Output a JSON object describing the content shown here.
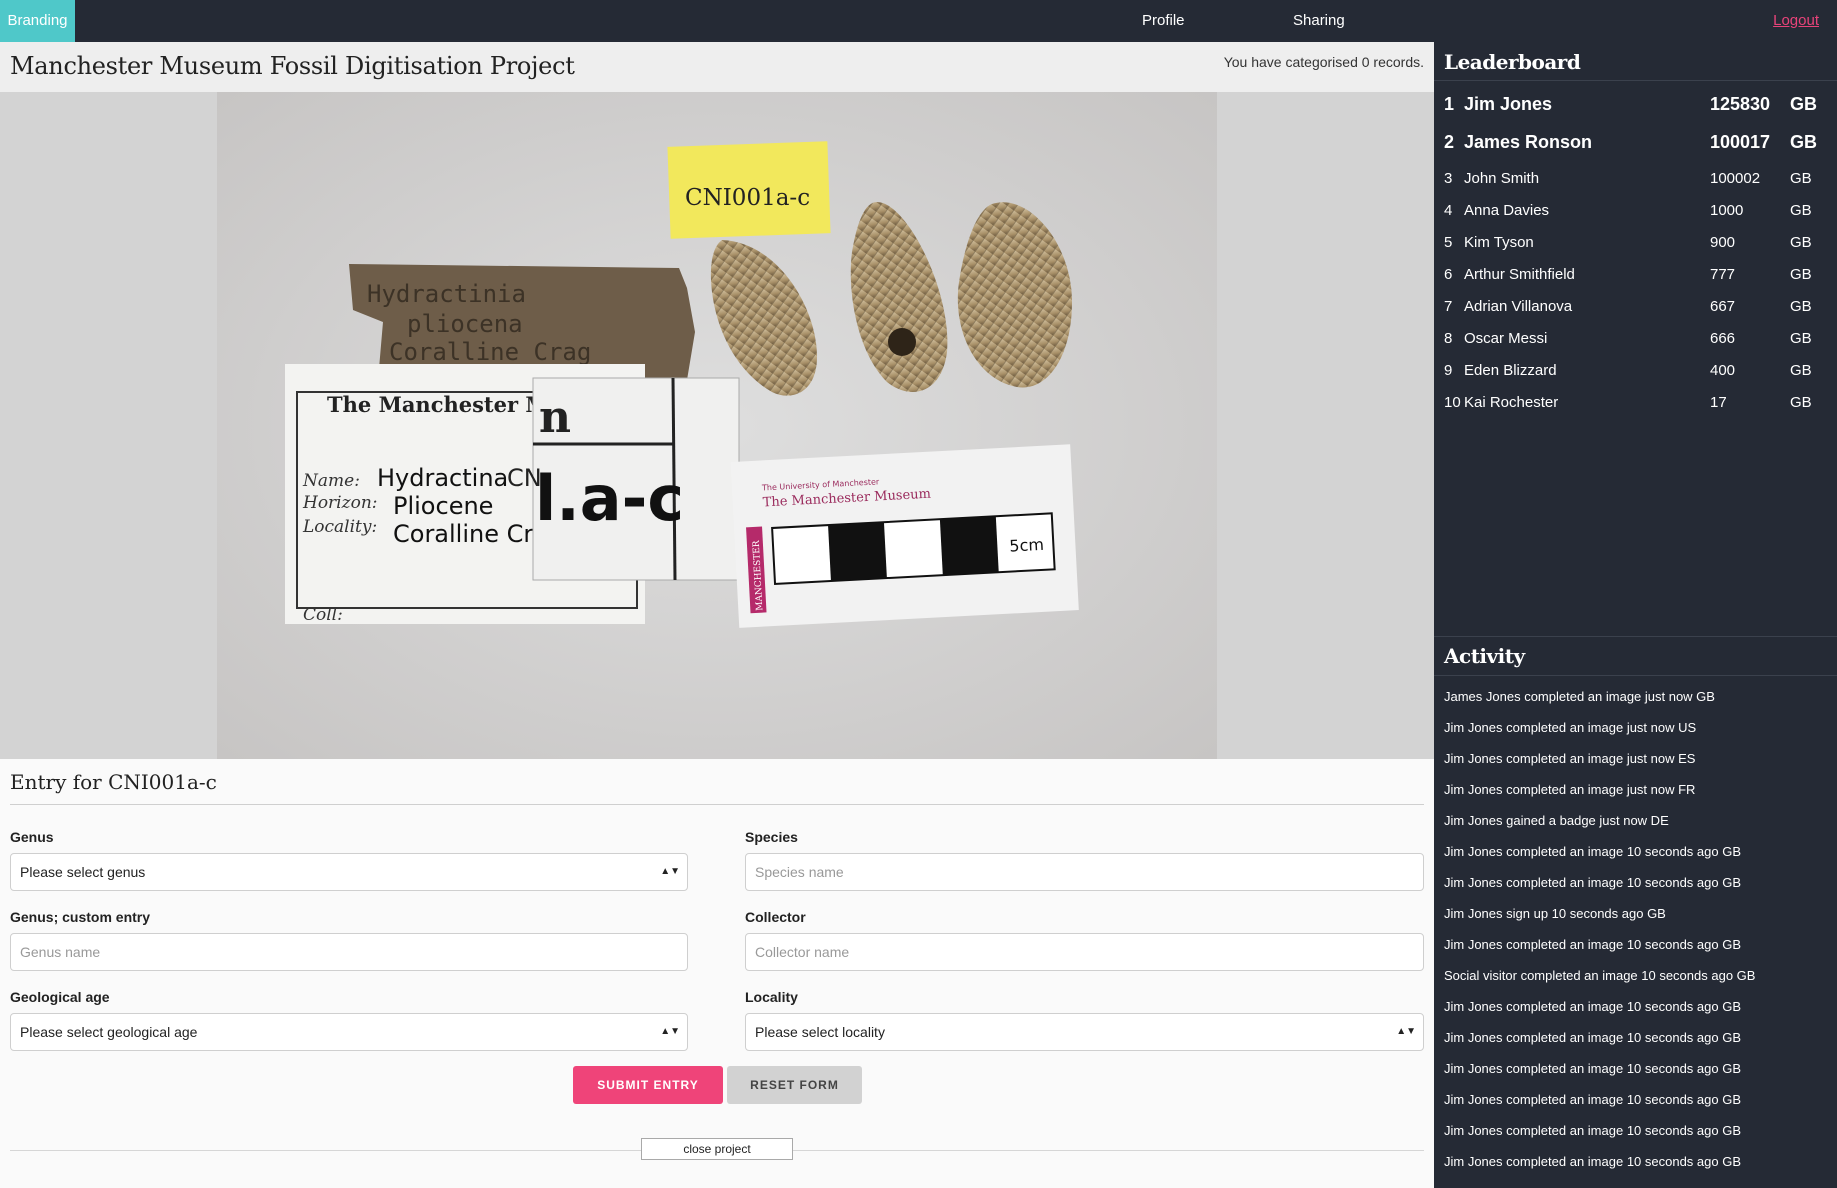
{
  "nav": {
    "brand": "Branding",
    "profile": "Profile",
    "sharing": "Sharing",
    "logout": "Logout"
  },
  "project": {
    "title": "Manchester Museum Fossil Digitisation Project",
    "record_count": "You have categorised 0 records."
  },
  "specimen": {
    "yellow_label": "CNI001a-c",
    "old_label_text": [
      "Hydractinia",
      "pliocena",
      "Coralline Crag"
    ],
    "card_header": "The Manchester M",
    "card_name_label": "Name:",
    "card_name_value": "Hydractina",
    "card_horizon_label": "Horizon:",
    "card_horizon_value": "Pliocene",
    "card_locality_label": "Locality:",
    "card_locality_value": "Coralline Crag",
    "card_coll_label": "Coll:",
    "zoom_text": "l.a-c",
    "zoom_top": "n",
    "zoom_corner": "CN",
    "scale_university": "The University of Manchester",
    "scale_museum": "The Manchester Museum",
    "scale_side": "MANCHESTER",
    "scale_unit": "5cm"
  },
  "entry": {
    "title": "Entry for CNI001a-c",
    "genus_label": "Genus",
    "genus_value": "Please select genus",
    "species_label": "Species",
    "species_placeholder": "Species name",
    "genus_custom_label": "Genus; custom entry",
    "genus_custom_placeholder": "Genus name",
    "collector_label": "Collector",
    "collector_placeholder": "Collector name",
    "geo_age_label": "Geological age",
    "geo_age_value": "Please select geological age",
    "locality_label": "Locality",
    "locality_value": "Please select locality",
    "submit": "SUBMIT ENTRY",
    "reset": "RESET FORM",
    "close": "close project"
  },
  "leaderboard": {
    "title": "Leaderboard",
    "rows": [
      {
        "rank": "1",
        "name": "Jim Jones",
        "score": "125830",
        "cc": "GB"
      },
      {
        "rank": "2",
        "name": "James Ronson",
        "score": "100017",
        "cc": "GB"
      },
      {
        "rank": "3",
        "name": "John Smith",
        "score": "100002",
        "cc": "GB"
      },
      {
        "rank": "4",
        "name": "Anna Davies",
        "score": "1000",
        "cc": "GB"
      },
      {
        "rank": "5",
        "name": "Kim Tyson",
        "score": "900",
        "cc": "GB"
      },
      {
        "rank": "6",
        "name": "Arthur Smithfield",
        "score": "777",
        "cc": "GB"
      },
      {
        "rank": "7",
        "name": "Adrian Villanova",
        "score": "667",
        "cc": "GB"
      },
      {
        "rank": "8",
        "name": "Oscar Messi",
        "score": "666",
        "cc": "GB"
      },
      {
        "rank": "9",
        "name": "Eden Blizzard",
        "score": "400",
        "cc": "GB"
      },
      {
        "rank": "10",
        "name": "Kai Rochester",
        "score": "17",
        "cc": "GB"
      }
    ]
  },
  "activity": {
    "title": "Activity",
    "items": [
      "James Jones completed an image just now GB",
      "Jim Jones completed an image just now US",
      "Jim Jones completed an image just now ES",
      "Jim Jones completed an image just now FR",
      "Jim Jones gained a badge just now DE",
      "Jim Jones completed an image 10 seconds ago GB",
      "Jim Jones completed an image 10 seconds ago GB",
      "Jim Jones sign up 10 seconds ago GB",
      "Jim Jones completed an image 10 seconds ago GB",
      "Social visitor completed an image 10 seconds ago GB",
      "Jim Jones completed an image 10 seconds ago GB",
      "Jim Jones completed an image 10 seconds ago GB",
      "Jim Jones completed an image 10 seconds ago GB",
      "Jim Jones completed an image 10 seconds ago GB",
      "Jim Jones completed an image 10 seconds ago GB",
      "Jim Jones completed an image 10 seconds ago GB"
    ]
  }
}
